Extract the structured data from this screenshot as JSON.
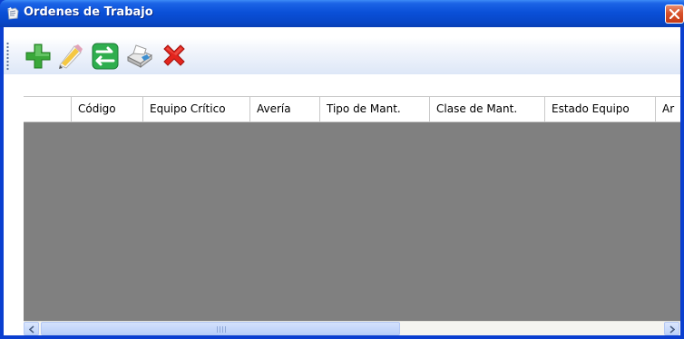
{
  "window": {
    "title": "Ordenes de Trabajo",
    "icon": "form-icon",
    "close": "close-icon"
  },
  "toolbar": {
    "buttons": [
      {
        "name": "add-button",
        "icon": "plus-icon",
        "color": "#2e9b2e"
      },
      {
        "name": "edit-button",
        "icon": "pencil-icon",
        "color": "#f2c23a"
      },
      {
        "name": "transfer-button",
        "icon": "arrows-icon",
        "color": "#2aa84a"
      },
      {
        "name": "print-button",
        "icon": "printer-icon",
        "color": "#4a90c8"
      },
      {
        "name": "delete-button",
        "icon": "x-icon",
        "color": "#e0241c"
      }
    ]
  },
  "grid": {
    "columns": [
      "",
      "Código",
      "Equipo Crítico",
      "Avería",
      "Tipo de Mant.",
      "Clase de Mant.",
      "Estado Equipo",
      "Ar"
    ],
    "background": "#808080"
  },
  "colors": {
    "titlebar": "#0a50d8",
    "close": "#d8512a",
    "client": "#ffffff"
  }
}
